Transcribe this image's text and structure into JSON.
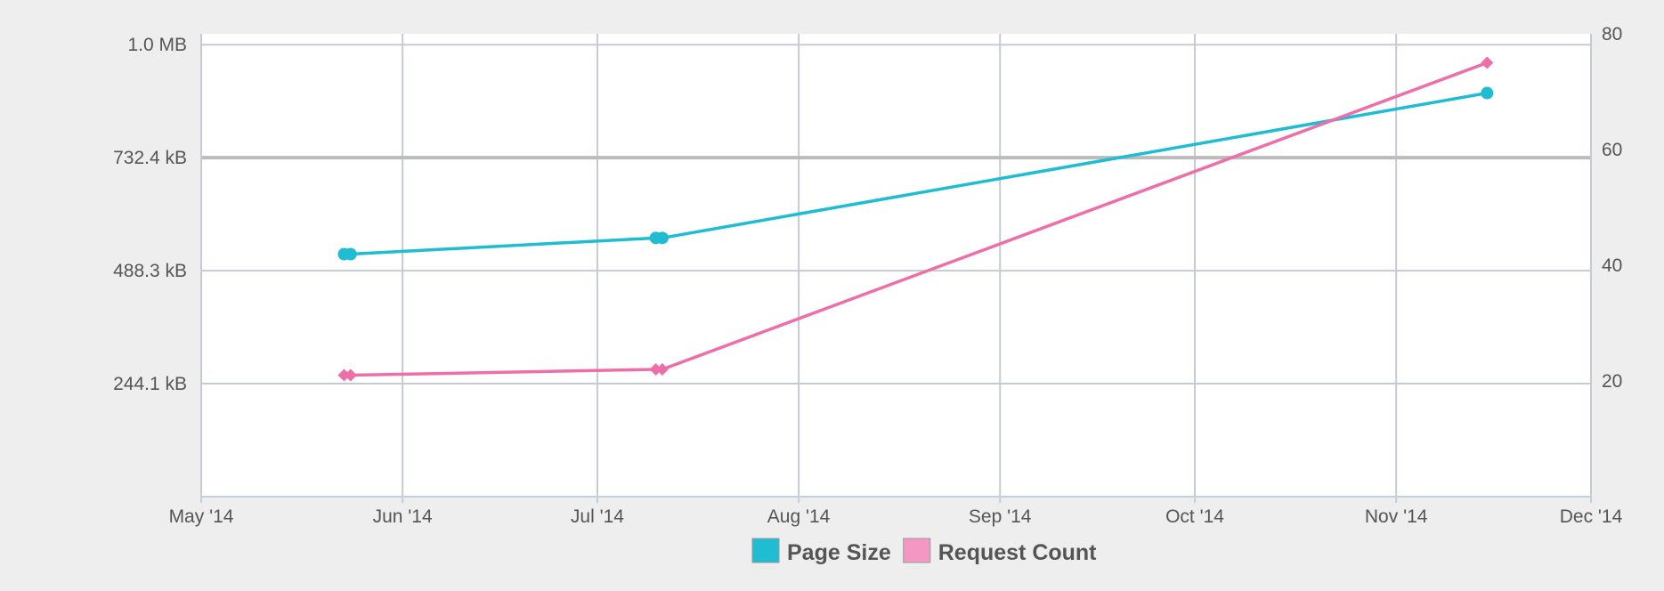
{
  "chart_data": {
    "type": "line",
    "title": "",
    "xlabel": "",
    "ylabel": "",
    "x_axis": {
      "type": "date",
      "range": [
        "2014-05-01",
        "2014-12-01"
      ],
      "tick_dates": [
        "2014-05-01",
        "2014-06-01",
        "2014-07-01",
        "2014-08-01",
        "2014-09-01",
        "2014-10-01",
        "2014-11-01",
        "2014-12-01"
      ],
      "tick_labels": [
        "May '14",
        "Jun '14",
        "Jul '14",
        "Aug '14",
        "Sep '14",
        "Oct '14",
        "Nov '14",
        "Dec '14"
      ],
      "grid": true
    },
    "y_axis_left": {
      "unit": "bytes",
      "range": [
        0,
        1000000
      ],
      "tick_values": [
        244140.625,
        488281.25,
        732421.875,
        976562.5
      ],
      "tick_labels": [
        "244.1 kB",
        "488.3 kB",
        "732.4 kB",
        "1.0 MB"
      ],
      "grid": true
    },
    "y_axis_right": {
      "range": [
        0,
        80
      ],
      "tick_values": [
        20,
        40,
        60,
        80
      ],
      "tick_labels": [
        "20",
        "40",
        "60",
        "80"
      ]
    },
    "series": [
      {
        "name": "Page Size",
        "axis": "left",
        "color": "#1fbcd2",
        "marker": "circle",
        "x": [
          "2014-05-23",
          "2014-05-24",
          "2014-07-10",
          "2014-07-11",
          "2014-11-15"
        ],
        "y": [
          524000,
          524000,
          559000,
          559000,
          872000
        ]
      },
      {
        "name": "Request Count",
        "axis": "right",
        "color": "#ee6fa8",
        "marker": "diamond",
        "x": [
          "2014-05-23",
          "2014-05-24",
          "2014-07-10",
          "2014-07-11",
          "2014-11-15"
        ],
        "y": [
          21,
          21,
          22,
          22,
          75
        ]
      }
    ],
    "legend": {
      "position": "bottom-center",
      "entries": [
        {
          "label": "Page Size",
          "color": "#1fbcd2"
        },
        {
          "label": "Request Count",
          "color": "#f597c3"
        }
      ]
    }
  }
}
